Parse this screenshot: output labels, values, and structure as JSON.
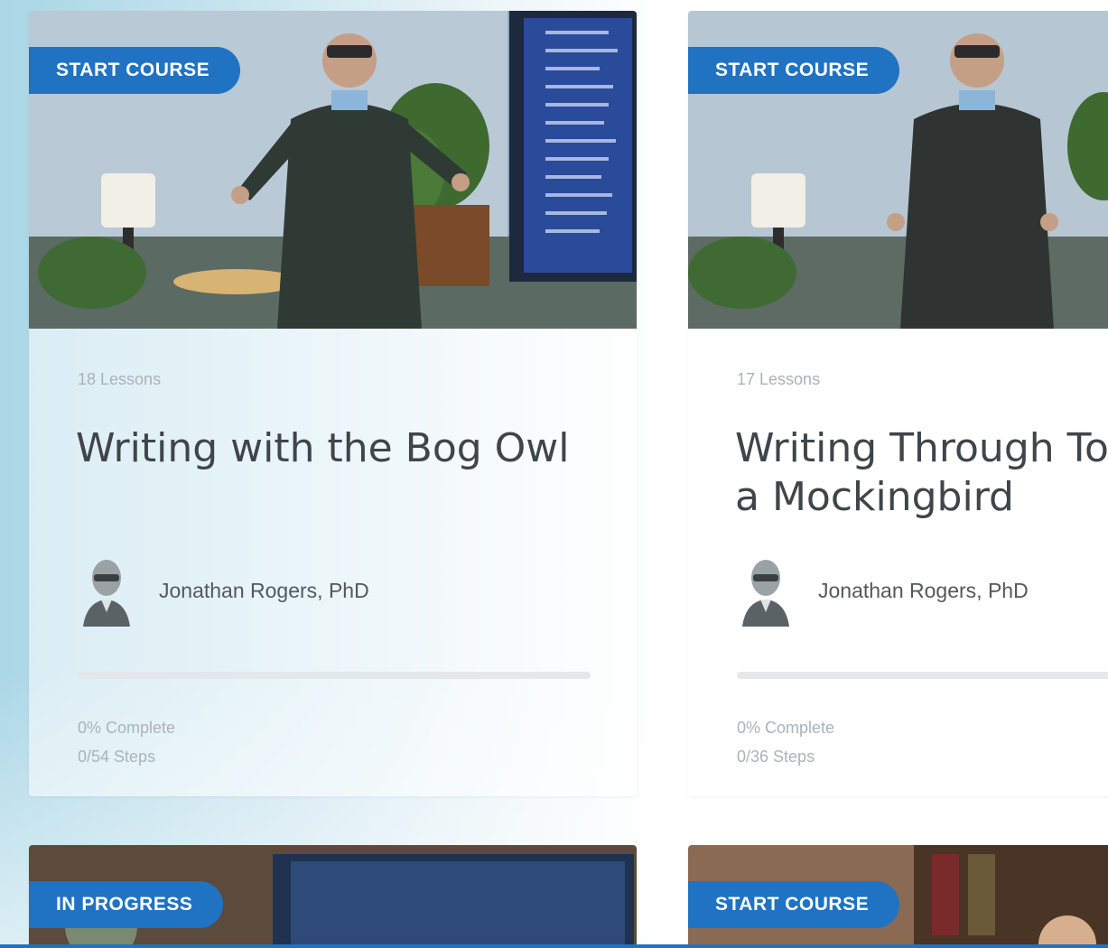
{
  "courses": [
    {
      "badge": "START COURSE",
      "lessons": "18 Lessons",
      "title": "Writing with the Bog Owl",
      "author": "Jonathan Rogers, PhD",
      "progress": 0,
      "percent_text": "0% Complete",
      "steps_text": "0/54 Steps"
    },
    {
      "badge": "START COURSE",
      "lessons": "17 Lessons",
      "title": "Writing Through To Kill a Mockingbird",
      "author": "Jonathan Rogers, PhD",
      "progress": 0,
      "percent_text": "0% Complete",
      "steps_text": "0/36 Steps"
    },
    {
      "badge": "IN PROGRESS"
    },
    {
      "badge": "START COURSE"
    }
  ],
  "colors": {
    "badge": "#1f73c2",
    "title": "#3f4549",
    "muted": "#aab3b8"
  }
}
